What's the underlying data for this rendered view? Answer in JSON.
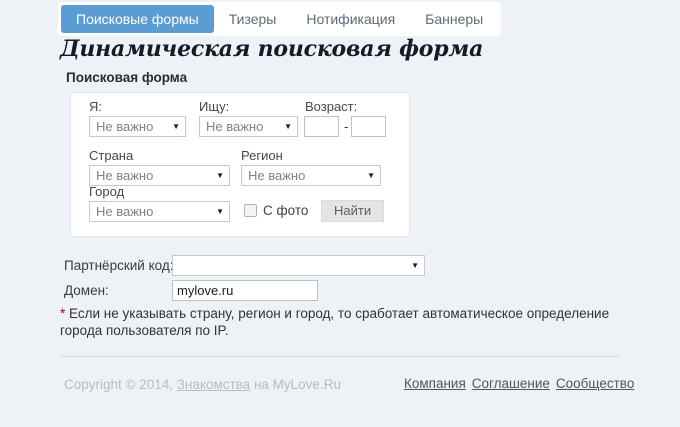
{
  "tabs": {
    "items": [
      {
        "label": "Поисковые формы",
        "active": true
      },
      {
        "label": "Тизеры",
        "active": false
      },
      {
        "label": "Нотификация",
        "active": false
      },
      {
        "label": "Баннеры",
        "active": false
      }
    ],
    "active_color": "#5b9dd3"
  },
  "page_title": "Динамическая поисковая форма",
  "search_form": {
    "heading": "Поисковая форма",
    "i_am": {
      "label": "Я:",
      "value": "Не важно"
    },
    "seeking": {
      "label": "Ищу:",
      "value": "Не важно"
    },
    "age": {
      "label": "Возраст:",
      "from": "",
      "to": "",
      "separator": "-"
    },
    "country": {
      "label": "Страна",
      "value": "Не важно"
    },
    "region": {
      "label": "Регион",
      "value": "Не важно"
    },
    "city": {
      "label": "Город",
      "value": "Не важно"
    },
    "with_photo": {
      "label": "С фото",
      "checked": false
    },
    "submit_label": "Найти",
    "select_arrow": "▼"
  },
  "settings": {
    "partner_code": {
      "label": "Партнёрский код:",
      "value": ""
    },
    "domain": {
      "label": "Домен:",
      "value": "mylove.ru"
    }
  },
  "note": {
    "asterisk": "*",
    "text": " Если не указывать страну, регион и город, то сработает автоматическое определение города пользователя по IP."
  },
  "footer": {
    "copyright_prefix": "Copyright © 2014, ",
    "copyright_link": "Знакомства",
    "copyright_suffix": " на MyLove.Ru",
    "links": [
      "Компания",
      "Соглашение",
      "Сообщество"
    ]
  }
}
